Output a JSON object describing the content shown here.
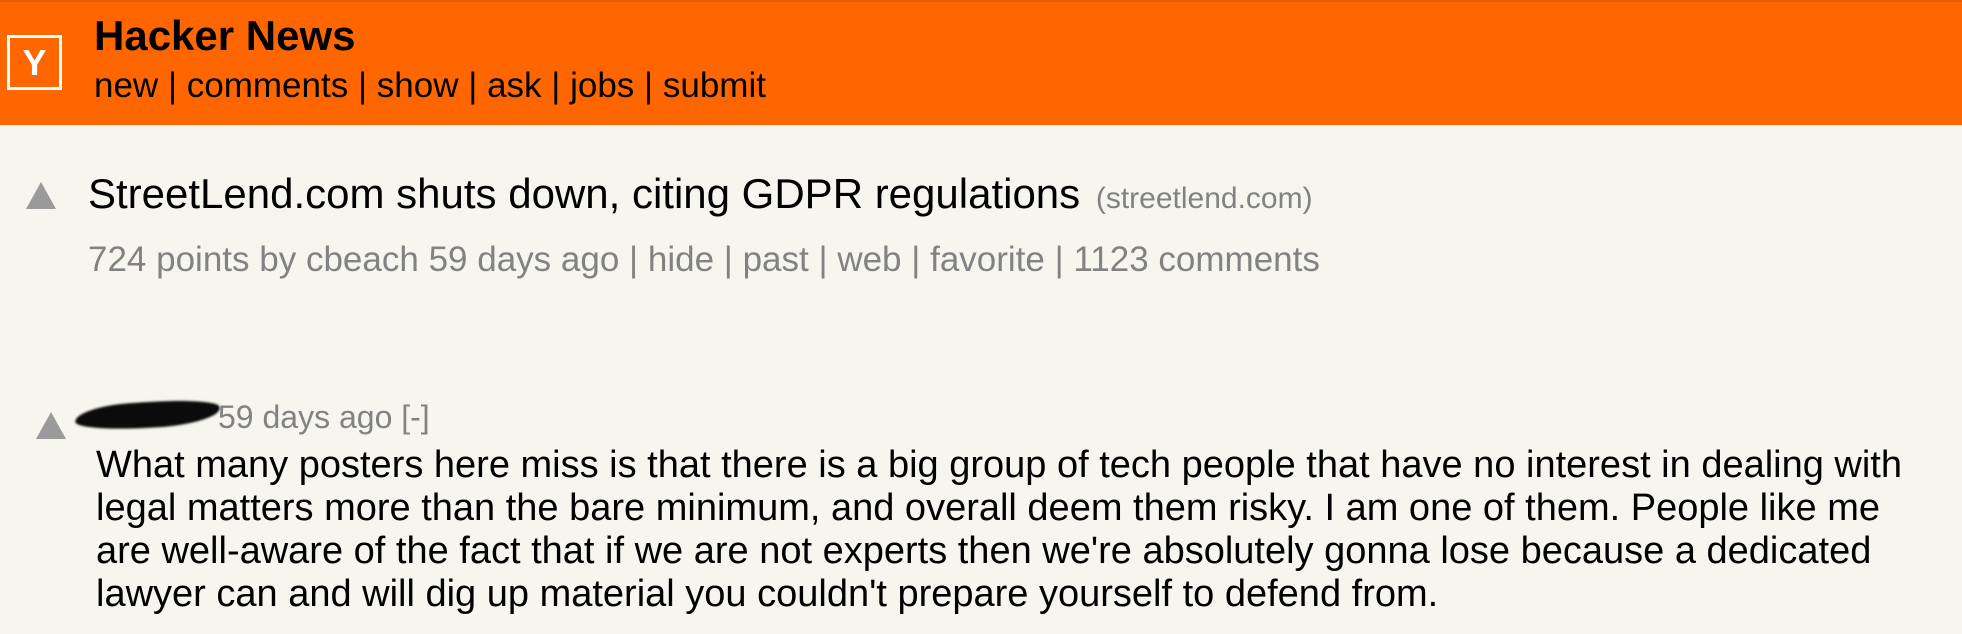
{
  "header": {
    "logo_letter": "Y",
    "title": "Hacker News",
    "nav": [
      "new",
      "comments",
      "show",
      "ask",
      "jobs",
      "submit"
    ],
    "separator": "|"
  },
  "story": {
    "title": "StreetLend.com shuts down, citing GDPR regulations",
    "domain": "(streetlend.com)",
    "points": "724 points",
    "by_word": "by",
    "user": "cbeach",
    "age": "59 days ago",
    "links": {
      "hide": "hide",
      "past": "past",
      "web": "web",
      "favorite": "favorite",
      "comments": "1123 comments"
    }
  },
  "comment": {
    "age": "59 days ago",
    "toggle": "[-]",
    "text": "What many posters here miss is that there is a big group of tech people that have no interest in dealing with legal matters more than the bare minimum, and overall deem them risky. I am one of them. People like me are well-aware of the fact that if we are not experts then we're absolutely gonna lose because a dedicated lawyer can and will dig up material you couldn't prepare yourself to defend from."
  },
  "colors": {
    "header_bg": "#ff6600",
    "page_bg": "#f6f6ef",
    "subtext": "#828282",
    "vote_arrow": "#9a9a9a"
  }
}
